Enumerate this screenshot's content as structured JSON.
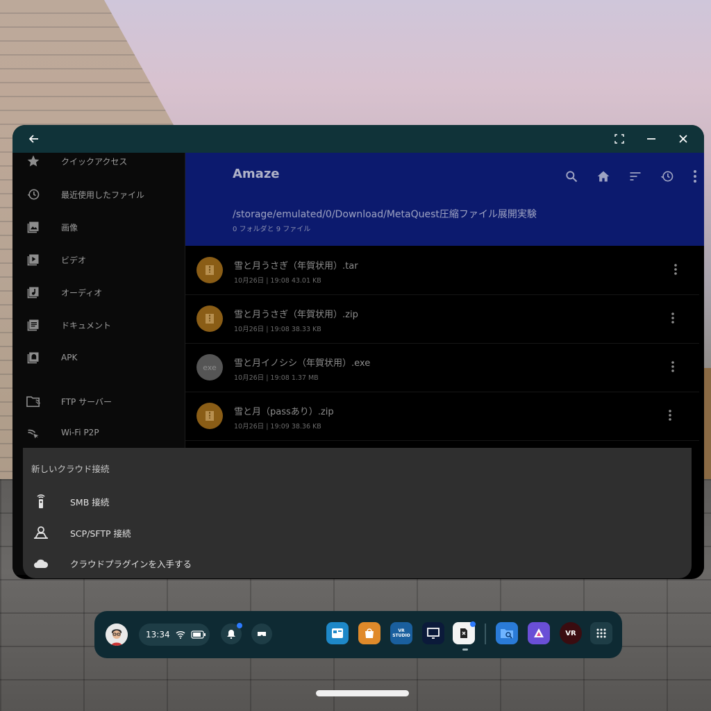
{
  "window": {
    "sidebar": {
      "items": [
        {
          "label": "クイックアクセス",
          "icon": "star-icon"
        },
        {
          "label": "最近使用したファイル",
          "icon": "history-icon"
        },
        {
          "label": "画像",
          "icon": "image-icon"
        },
        {
          "label": "ビデオ",
          "icon": "video-icon"
        },
        {
          "label": "オーディオ",
          "icon": "audio-icon"
        },
        {
          "label": "ドキュメント",
          "icon": "document-icon"
        },
        {
          "label": "APK",
          "icon": "apk-icon"
        },
        {
          "label": "FTP サーバー",
          "icon": "ftp-icon"
        },
        {
          "label": "Wi-Fi P2P",
          "icon": "wifi-p2p-icon"
        }
      ]
    },
    "header": {
      "app_title": "Amaze",
      "path": "/storage/emulated/0/Download/MetaQuest圧縮ファイル展開実験",
      "count": "0 フォルダと 9 ファイル"
    },
    "files": [
      {
        "name": "雪と月うさぎ（年賀状用）.tar",
        "meta": "10月26日 | 19:08   43.01 KB",
        "type": "archive"
      },
      {
        "name": "雪と月うさぎ（年賀状用）.zip",
        "meta": "10月26日 | 19:08   38.33 KB",
        "type": "archive"
      },
      {
        "name": "雪と月イノシシ（年賀状用）.exe",
        "meta": "10月26日 | 19:08   1.37 MB",
        "type": "exe",
        "thumb_label": "exe"
      },
      {
        "name": "雪と月（passあり）.zip",
        "meta": "10月26日 | 19:09   38.36 KB",
        "type": "archive"
      }
    ]
  },
  "sheet": {
    "title": "新しいクラウド接続",
    "items": [
      {
        "label": "SMB 接続",
        "icon": "smb-icon"
      },
      {
        "label": "SCP/SFTP 接続",
        "icon": "sftp-icon"
      },
      {
        "label": "クラウドプラグインを入手する",
        "icon": "cloud-icon"
      }
    ]
  },
  "taskbar": {
    "time": "13:34",
    "app_labels": {
      "vr_studio": "VR STUDIO",
      "vr_station": "VR"
    },
    "colors": {
      "accent": "#2d7bff",
      "header": "#0c1a6e",
      "titlebar": "#103339"
    }
  }
}
